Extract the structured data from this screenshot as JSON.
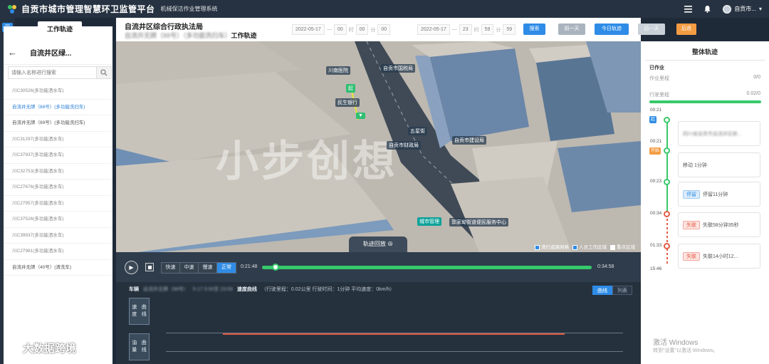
{
  "app": {
    "title": "自贡市城市管理智慧环卫监管平台",
    "subtitle": "机械保洁作业管理系统",
    "user": "自贡市..."
  },
  "left_panel": {
    "tab_label": "工作轨迹",
    "header_title": "自流井区绿...",
    "search_placeholder": "请输入名称进行搜索",
    "vehicles": [
      {
        "label": "川C30526(多功能洒水车)",
        "state": "normal"
      },
      {
        "label": "自流井无牌（88号）(多功能洗扫车)",
        "state": "active"
      },
      {
        "label": "自流井无牌（89号）(多功能洗扫车)",
        "state": "dark"
      },
      {
        "label": "川C31297(多功能洒水车)",
        "state": "normal"
      },
      {
        "label": "川C37937(多功能洒水车)",
        "state": "normal"
      },
      {
        "label": "川C32753(多功能洒水车)",
        "state": "normal"
      },
      {
        "label": "川C27676(多功能洒水车)",
        "state": "normal"
      },
      {
        "label": "川C27957(多功能洒水车)",
        "state": "normal"
      },
      {
        "label": "川C37526(多功能洒水车)",
        "state": "normal"
      },
      {
        "label": "川C39937(多功能洒水车)",
        "state": "normal"
      },
      {
        "label": "川C27981(多功能洒水车)",
        "state": "normal"
      },
      {
        "label": "自流井无牌（40号）(清洗车)",
        "state": "dark"
      }
    ]
  },
  "center_header": {
    "org": "自流井区综合行政执法局",
    "vehicle_blur": "自流井无牌（88号）（多功能洗扫车）",
    "suffix": "工作轨迹",
    "start_date": "2022-05-17",
    "start_h": "00",
    "start_m": "00",
    "start_s": "00",
    "end_date": "2022-05-17",
    "end_h": "23",
    "end_m": "59",
    "end_s": "59",
    "search_btn": "搜索",
    "prev_day_btn": "前一天",
    "today_btn": "今日轨迹",
    "next_day_btn": "后一天",
    "back_btn": "后退"
  },
  "map": {
    "watermark": "小步创想",
    "replay_tab": "轨迹回放 ⊕",
    "labels": {
      "a": "川南医院",
      "b": "自贡市国税局",
      "c": "民生银行",
      "d": "自贡市财政局",
      "e": "自贡市建设局",
      "f": "城市管理",
      "g": "郭家坳街道便民服务中心",
      "h": "五星街"
    },
    "legend": {
      "sanitation": "清扫道路网格",
      "staff_area": "人员工作区域",
      "key_area": "重点区域"
    }
  },
  "playback": {
    "speeds": [
      "快速",
      "中速",
      "慢速",
      "正常"
    ],
    "active_speed": 3,
    "time_start": "0:21:48",
    "time_end": "0:34:58",
    "progress": 0.04
  },
  "lower_chart": {
    "car_label": "车辆",
    "car_name_blur": "自流井无牌（88号）",
    "date_blur": "5-17 0:00至 23:59",
    "curve_label": "速度曲线",
    "stats": "（行驶里程：0.02公里 行驶时间：1分钟 平均速度：0km/h）",
    "tabs": [
      "曲线",
      "列表"
    ],
    "active_tab": 0,
    "side_tabs": [
      {
        "l1": "速度",
        "l2": "曲线"
      },
      {
        "l1": "油量",
        "l2": "曲线"
      }
    ]
  },
  "right_panel": {
    "title": "整体轨迹",
    "section": "已作业",
    "rows": [
      {
        "label": "作业里程",
        "value": "0/0"
      },
      {
        "label": "行驶里程",
        "value": "0.02/0"
      }
    ],
    "timeline": [
      {
        "time": "00:21",
        "tag": "起",
        "tag_color": "blue"
      },
      {
        "time": "00:21",
        "tag": "开始",
        "tag_color": "orange",
        "card": "四川省自贡市自流井区新..."
      },
      {
        "time": "",
        "card": "移动 1分钟"
      },
      {
        "time": "00:23",
        "pill": "停留",
        "pill_color": "blue",
        "card_text": "停留11分钟"
      },
      {
        "time": "00:34",
        "pill": "失联",
        "pill_color": "red",
        "card_text": "失联58分钟35秒"
      },
      {
        "time": "01:33",
        "pill": "失联",
        "pill_color": "red",
        "card_text": "失联14小时12..."
      },
      {
        "time": "15:46"
      }
    ]
  },
  "windows": {
    "line1": "激活 Windows",
    "line2": "转到\"设置\"以激活 Windows。"
  },
  "corner_watermark": "大数据跨境"
}
